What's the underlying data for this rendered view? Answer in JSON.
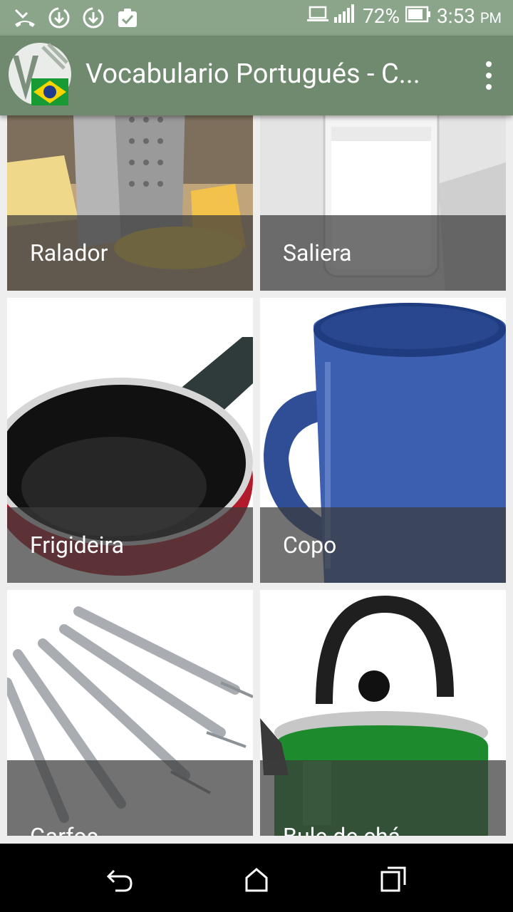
{
  "status_bar": {
    "battery": "72%",
    "time": "3:53",
    "ampm": "PM"
  },
  "app_bar": {
    "title": "Vocabulario Portugués - C..."
  },
  "cards": [
    {
      "label": "Ralador",
      "image": "cheese-grater"
    },
    {
      "label": "Saliera",
      "image": "salt-shaker"
    },
    {
      "label": "Frigideira",
      "image": "frying-pan"
    },
    {
      "label": "Copo",
      "image": "blue-mug"
    },
    {
      "label": "Garfos",
      "image": "forks"
    },
    {
      "label": "Bule de chá",
      "image": "green-kettle"
    }
  ],
  "colors": {
    "status_bar": "#8aa58a",
    "app_bar": "#6f8a6f"
  },
  "nav": {
    "icons": [
      "back-icon",
      "home-icon",
      "recents-icon"
    ]
  }
}
